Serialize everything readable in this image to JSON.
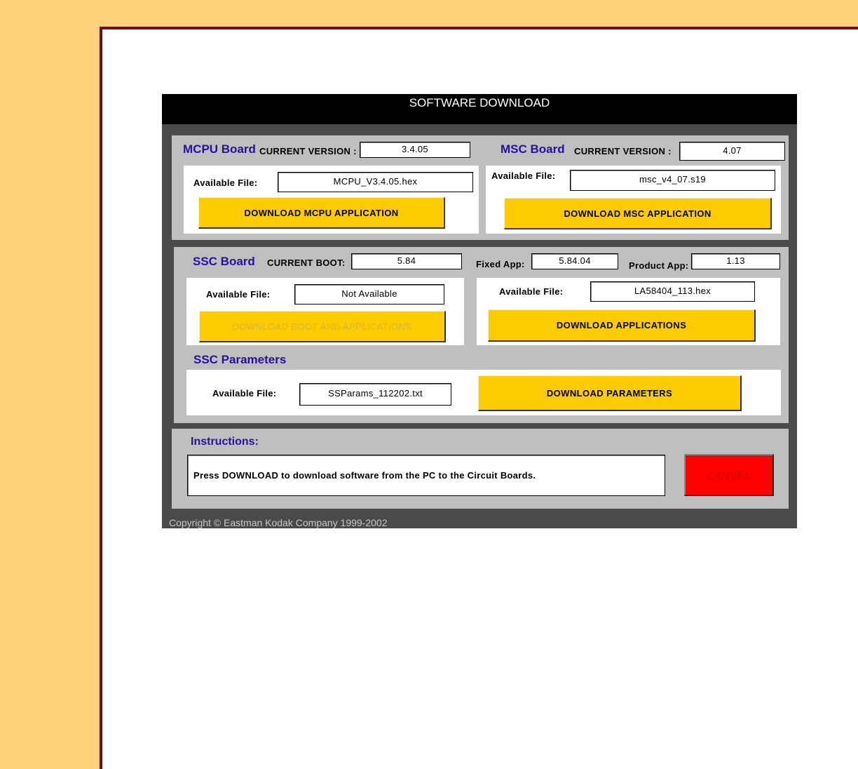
{
  "window": {
    "title": "SOFTWARE DOWNLOAD"
  },
  "mcpu": {
    "title": "MCPU Board",
    "version_label": "CURRENT VERSION :",
    "version": "3.4.05",
    "file_label": "Available File:",
    "file": "MCPU_V3.4.05.hex",
    "button": "DOWNLOAD MCPU APPLICATION"
  },
  "msc": {
    "title": "MSC Board",
    "version_label": "CURRENT VERSION :",
    "version": "4.07",
    "file_label": "Available File:",
    "file": "msc_v4_07.s19",
    "button": "DOWNLOAD MSC APPLICATION"
  },
  "ssc": {
    "title": "SSC Board",
    "boot_label": "CURRENT BOOT:",
    "boot": "5.84",
    "fixed_label": "Fixed App:",
    "fixed": "5.84.04",
    "product_label": "Product App:",
    "product": "1.13",
    "boot_file_label": "Available File:",
    "boot_file": "Not Available",
    "boot_button": "DOWNLOAD BOOT AND APPLICATIONS",
    "app_file_label": "Available File:",
    "app_file": "LA58404_113.hex",
    "app_button": "DOWNLOAD APPLICATIONS"
  },
  "params": {
    "title": "SSC Parameters",
    "file_label": "Available File:",
    "file": "SSParams_112202.txt",
    "button": "DOWNLOAD PARAMETERS"
  },
  "instructions": {
    "title": "Instructions:",
    "text": "Press DOWNLOAD to download software from the PC to the Circuit Boards.",
    "cancel": "CANCEL"
  },
  "footer": {
    "copyright": "Copyright © Eastman Kodak Company 1999-2002"
  },
  "colors": {
    "button": "#fccc00",
    "cancel": "#ff0000",
    "board_title": "#2a0f9c",
    "page_bg": "#ffd27a"
  }
}
